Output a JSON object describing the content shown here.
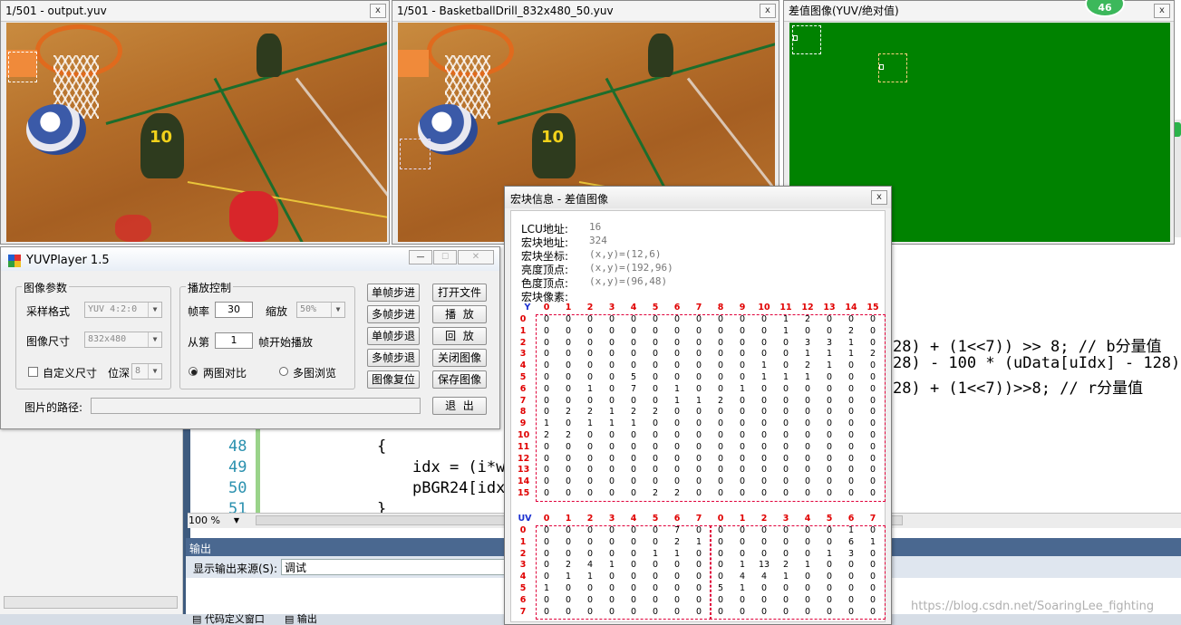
{
  "windows": {
    "frame1_title": "1/501 - output.yuv",
    "frame2_title": "1/501 - BasketballDrill_832x480_50.yuv",
    "diff_title": "差值图像(YUV/绝对值)",
    "badge": "46",
    "close_glyph": "x",
    "player_number": "10"
  },
  "vs": {
    "code_right": [
      "28) + (1<<7)) >> 8; // b分量值",
      "28) - 100 * (uData[uIdx] - 128)",
      "28) + (1<<7))>>8; // r分量值"
    ],
    "line_numbers": [
      "48",
      "49",
      "50",
      "51"
    ],
    "code_lines": [
      "{",
      "idx = (i*w",
      "pBGR24[idx",
      "}"
    ],
    "zoom": "100 %",
    "output_title": "输出",
    "output_source_label": "显示输出来源(S):",
    "output_source_value": "调试",
    "taskbar": [
      "代码定义窗口",
      "输出"
    ],
    "watermark": "https://blog.csdn.net/SoaringLee_fighting"
  },
  "player": {
    "title": "YUVPlayer 1.5",
    "group_image": "图像参数",
    "sampling_label": "采样格式",
    "sampling_value": "YUV 4:2:0",
    "size_label": "图像尺寸",
    "size_value": "832x480",
    "custom_size_label": "自定义尺寸",
    "bitdepth_label": "位深",
    "bitdepth_value": "8",
    "group_play": "播放控制",
    "fps_label": "帧率",
    "fps_value": "30",
    "zoom_label": "缩放",
    "zoom_value": "50%",
    "from_label": "从第",
    "from_value": "1",
    "from_suffix": "帧开始播放",
    "radio_compare": "两图对比",
    "radio_multi": "多图浏览",
    "buttons_col1": [
      "单帧步进",
      "多帧步进",
      "单帧步退",
      "多帧步退",
      "图像复位"
    ],
    "buttons_col2": [
      "打开文件",
      "播  放",
      "回  放",
      "关闭图像",
      "保存图像"
    ],
    "exit_label": "退  出",
    "path_label": "图片的路径:",
    "path_value": ""
  },
  "mb": {
    "title": "宏块信息 - 差值图像",
    "info_labels": [
      "LCU地址:",
      "宏块地址:",
      "宏块坐标:",
      "亮度顶点:",
      "色度顶点:",
      "宏块像素:"
    ],
    "info_values": [
      "16",
      "324",
      "(x,y)=(12,6)",
      "(x,y)=(192,96)",
      "(x,y)=(96,48)",
      ""
    ],
    "y_label": "Y",
    "uv_label": "UV",
    "y_cols": [
      "0",
      "1",
      "2",
      "3",
      "4",
      "5",
      "6",
      "7",
      "8",
      "9",
      "10",
      "11",
      "12",
      "13",
      "14",
      "15"
    ],
    "uv_cols": [
      "0",
      "1",
      "2",
      "3",
      "4",
      "5",
      "6",
      "7",
      "0",
      "1",
      "2",
      "3",
      "4",
      "5",
      "6",
      "7"
    ],
    "rows8": [
      "0",
      "1",
      "2",
      "3",
      "4",
      "5",
      "6",
      "7"
    ],
    "y_data": [
      [
        0,
        0,
        0,
        0,
        0,
        0,
        0,
        0,
        0,
        0,
        0,
        1,
        2,
        0,
        0,
        0
      ],
      [
        0,
        0,
        0,
        0,
        0,
        0,
        0,
        0,
        0,
        0,
        0,
        1,
        0,
        0,
        2,
        0
      ],
      [
        0,
        0,
        0,
        0,
        0,
        0,
        0,
        0,
        0,
        0,
        0,
        0,
        3,
        3,
        1,
        0
      ],
      [
        0,
        0,
        0,
        0,
        0,
        0,
        0,
        0,
        0,
        0,
        0,
        0,
        1,
        1,
        1,
        2
      ],
      [
        0,
        0,
        0,
        0,
        0,
        0,
        0,
        0,
        0,
        0,
        1,
        0,
        2,
        1,
        0,
        0
      ],
      [
        0,
        0,
        0,
        0,
        5,
        0,
        0,
        0,
        0,
        0,
        1,
        1,
        1,
        0,
        0,
        0
      ],
      [
        0,
        0,
        1,
        0,
        7,
        0,
        1,
        0,
        0,
        1,
        0,
        0,
        0,
        0,
        0,
        0
      ],
      [
        0,
        0,
        0,
        0,
        0,
        0,
        1,
        1,
        2,
        0,
        0,
        0,
        0,
        0,
        0,
        0
      ],
      [
        0,
        2,
        2,
        1,
        2,
        2,
        0,
        0,
        0,
        0,
        0,
        0,
        0,
        0,
        0,
        0
      ],
      [
        1,
        0,
        1,
        1,
        1,
        0,
        0,
        0,
        0,
        0,
        0,
        0,
        0,
        0,
        0,
        0
      ],
      [
        2,
        2,
        0,
        0,
        0,
        0,
        0,
        0,
        0,
        0,
        0,
        0,
        0,
        0,
        0,
        0
      ],
      [
        0,
        0,
        0,
        0,
        0,
        0,
        0,
        0,
        0,
        0,
        0,
        0,
        0,
        0,
        0,
        0
      ],
      [
        0,
        0,
        0,
        0,
        0,
        0,
        0,
        0,
        0,
        0,
        0,
        0,
        0,
        0,
        0,
        0
      ],
      [
        0,
        0,
        0,
        0,
        0,
        0,
        0,
        0,
        0,
        0,
        0,
        0,
        0,
        0,
        0,
        0
      ],
      [
        0,
        0,
        0,
        0,
        0,
        0,
        0,
        0,
        0,
        0,
        0,
        0,
        0,
        0,
        0,
        0
      ],
      [
        0,
        0,
        0,
        0,
        0,
        2,
        2,
        0,
        0,
        0,
        0,
        0,
        0,
        0,
        0,
        0
      ]
    ],
    "uv_data": [
      [
        0,
        0,
        0,
        0,
        0,
        0,
        7,
        0,
        0,
        0,
        0,
        0,
        0,
        0,
        1,
        0
      ],
      [
        0,
        0,
        0,
        0,
        0,
        0,
        2,
        1,
        0,
        0,
        0,
        0,
        0,
        0,
        6,
        1
      ],
      [
        0,
        0,
        0,
        0,
        0,
        1,
        1,
        0,
        0,
        0,
        0,
        0,
        0,
        1,
        3,
        0
      ],
      [
        0,
        2,
        4,
        1,
        0,
        0,
        0,
        0,
        0,
        1,
        13,
        2,
        1,
        0,
        0,
        0
      ],
      [
        0,
        1,
        1,
        0,
        0,
        0,
        0,
        0,
        0,
        4,
        4,
        1,
        0,
        0,
        0,
        0
      ],
      [
        1,
        0,
        0,
        0,
        0,
        0,
        0,
        0,
        5,
        1,
        0,
        0,
        0,
        0,
        0,
        0
      ],
      [
        0,
        0,
        0,
        0,
        0,
        0,
        0,
        0,
        0,
        0,
        0,
        0,
        0,
        0,
        0,
        0
      ],
      [
        0,
        0,
        0,
        0,
        0,
        0,
        0,
        0,
        0,
        0,
        0,
        0,
        0,
        0,
        0,
        0
      ]
    ]
  }
}
